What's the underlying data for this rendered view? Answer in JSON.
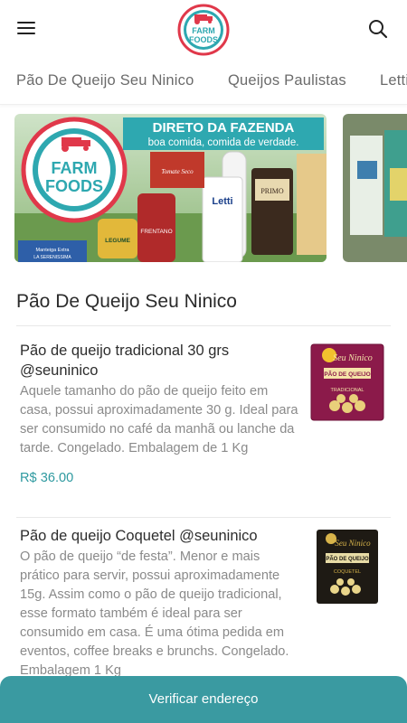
{
  "header": {
    "logo_line1": "FARM",
    "logo_line2": "FOODS"
  },
  "categories": [
    "Pão De Queijo Seu Ninico",
    "Queijos Paulistas",
    "Letti"
  ],
  "banner": {
    "headline": "DIRETO DA FAZENDA",
    "tagline": "boa comida, comida de verdade.",
    "logo_line1": "FARM",
    "logo_line2": "FOODS",
    "product_labels": [
      "Letti",
      "LEGUME",
      "FRENTANO",
      "PRIMO",
      "Tomate Seco",
      "Manteiga Extra",
      "LA SERENISSIMA"
    ]
  },
  "section": {
    "title": "Pão De Queijo Seu Ninico"
  },
  "products": [
    {
      "name": "Pão de queijo tradicional 30 grs @seuninico",
      "description": "Aquele tamanho do pão de queijo feito em casa, possui aproximadamente 30 g. Ideal para ser consumido no café da manhã ou lanche da tarde. Congelado. Embalagem de 1 Kg",
      "price": "R$ 36.00",
      "pack_brand": "Seu Ninico",
      "pack_label": "PÃO DE QUEIJO",
      "pack_sub": "TRADICIONAL",
      "pack_color": "#8b1a4a"
    },
    {
      "name": "Pão de queijo Coquetel @seuninico",
      "description": "O pão de queijo “de festa”. Menor e mais prático para servir, possui aproximadamente 15g. Assim como o pão de queijo tradicional, esse formato também é ideal para ser consumido em casa. É uma ótima pedida em eventos, coffee breaks e brunchs. Congelado. Embalagem 1 Kg",
      "price": "",
      "pack_brand": "Seu Ninico",
      "pack_label": "PÃO DE QUEIJO",
      "pack_sub": "COQUETEL",
      "pack_color": "#1e1a14"
    }
  ],
  "cta": {
    "label": "Verificar endereço"
  },
  "colors": {
    "accent": "#3a9aa1",
    "price": "#2f9aa0",
    "logo_red": "#e0384a",
    "logo_teal": "#2ea8b0"
  }
}
